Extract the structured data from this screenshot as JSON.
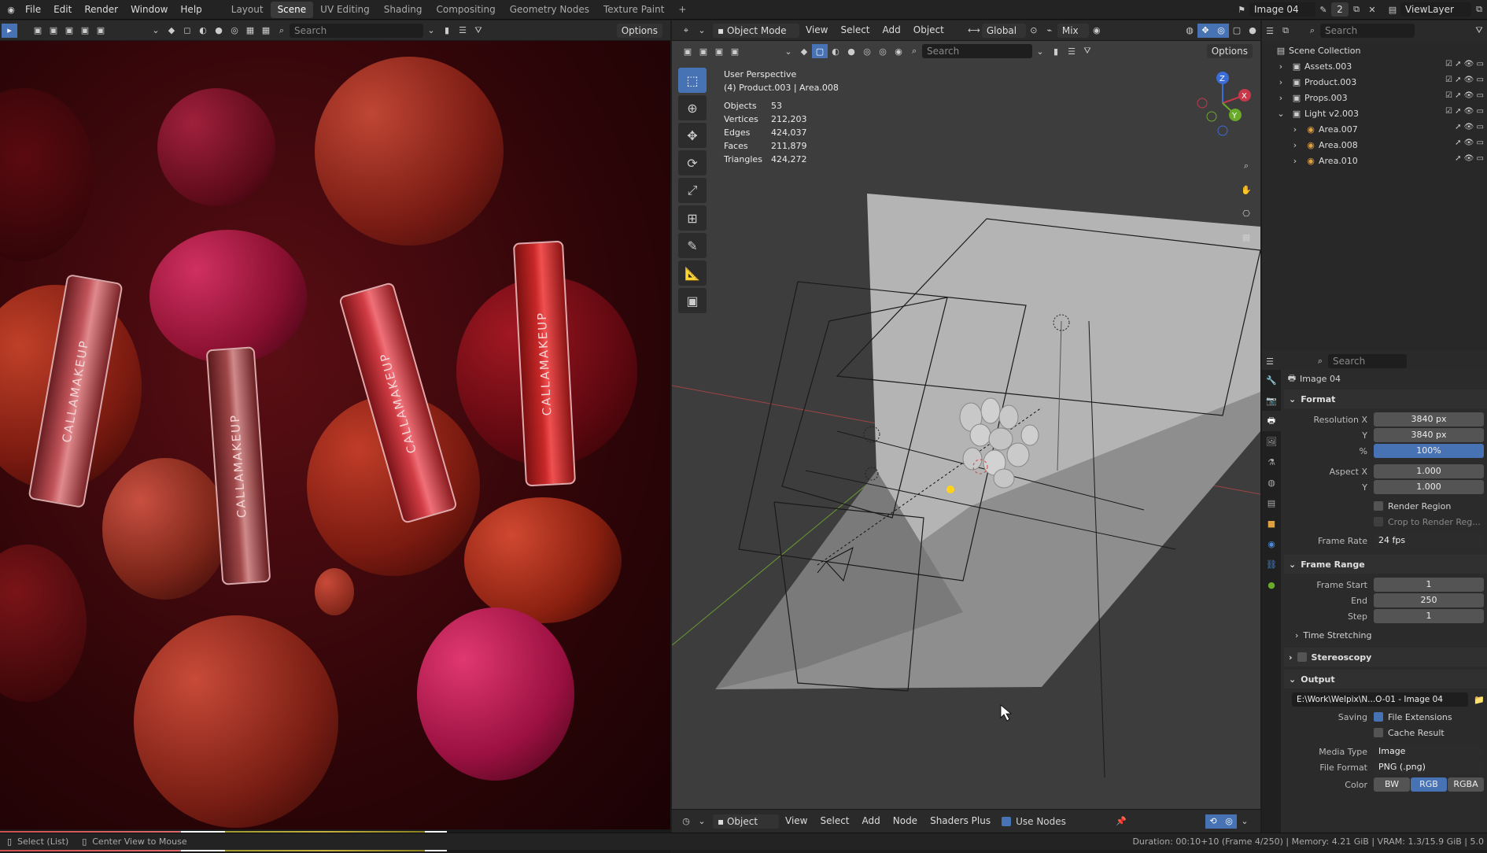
{
  "topbar": {
    "menus": [
      "File",
      "Edit",
      "Render",
      "Window",
      "Help"
    ],
    "workspaces": [
      "Layout",
      "Scene",
      "UV Editing",
      "Shading",
      "Compositing",
      "Geometry Nodes",
      "Texture Paint"
    ],
    "active_workspace": "Scene",
    "add_tab": "+",
    "scene_name": "Image 04",
    "scene_users": "2",
    "view_layer": "ViewLayer"
  },
  "image_editor": {
    "search_placeholder": "Search",
    "options_label": "Options",
    "render_label": "CALLAMAKEUP"
  },
  "viewport": {
    "mode": "Object Mode",
    "menus": [
      "View",
      "Select",
      "Add",
      "Object"
    ],
    "orientation": "Global",
    "snap_mode": "Mix",
    "search_placeholder": "Search",
    "options_label": "Options",
    "perspective": "User Perspective",
    "active_object": "(4) Product.003 | Area.008",
    "stats": [
      {
        "label": "Objects",
        "value": "53"
      },
      {
        "label": "Vertices",
        "value": "212,203"
      },
      {
        "label": "Edges",
        "value": "424,037"
      },
      {
        "label": "Faces",
        "value": "211,879"
      },
      {
        "label": "Triangles",
        "value": "424,272"
      }
    ],
    "gizmo": {
      "x": "X",
      "y": "Y",
      "z": "Z"
    }
  },
  "node_editor": {
    "type": "Object",
    "menus": [
      "View",
      "Select",
      "Add",
      "Node",
      "Shaders Plus"
    ],
    "use_nodes_label": "Use Nodes"
  },
  "outliner": {
    "search_placeholder": "Search",
    "root": "Scene Collection",
    "items": [
      {
        "name": "Assets.003",
        "indent": 1,
        "expanded": false
      },
      {
        "name": "Product.003",
        "indent": 1,
        "expanded": false
      },
      {
        "name": "Props.003",
        "indent": 1,
        "expanded": false
      },
      {
        "name": "Light v2.003",
        "indent": 1,
        "expanded": true
      },
      {
        "name": "Area.007",
        "indent": 2,
        "expanded": false
      },
      {
        "name": "Area.008",
        "indent": 2,
        "expanded": false
      },
      {
        "name": "Area.010",
        "indent": 2,
        "expanded": false
      }
    ]
  },
  "properties": {
    "search_placeholder": "Search",
    "context_name": "Image 04",
    "format": {
      "title": "Format",
      "resolution_x_label": "Resolution X",
      "resolution_x": "3840 px",
      "resolution_y_label": "Y",
      "resolution_y": "3840 px",
      "percent_label": "%",
      "percent": "100%",
      "aspect_x_label": "Aspect X",
      "aspect_x": "1.000",
      "aspect_y_label": "Y",
      "aspect_y": "1.000",
      "render_region": "Render Region",
      "crop": "Crop to Render Reg...",
      "frame_rate_label": "Frame Rate",
      "frame_rate": "24 fps"
    },
    "frame_range": {
      "title": "Frame Range",
      "start_label": "Frame Start",
      "start": "1",
      "end_label": "End",
      "end": "250",
      "step_label": "Step",
      "step": "1",
      "time_stretching": "Time Stretching"
    },
    "stereoscopy": "Stereoscopy",
    "output": {
      "title": "Output",
      "path": "E:\\Work\\Welpix\\N...O-01 - Image 04",
      "saving_label": "Saving",
      "file_extensions": "File Extensions",
      "cache_result": "Cache Result",
      "media_type_label": "Media Type",
      "media_type": "Image",
      "file_format_label": "File Format",
      "file_format": "PNG (.png)",
      "color_label": "Color",
      "color_options": [
        "BW",
        "RGB",
        "RGBA"
      ],
      "color_selected": "RGB"
    }
  },
  "statusbar": {
    "left1": "Select (List)",
    "left2": "Center View to Mouse",
    "right": "Duration: 00:10+10 (Frame 4/250) | Memory: 4.21 GiB | VRAM: 1.3/15.9 GiB | 5.0"
  },
  "colors": {
    "accent": "#4772b3",
    "header": "#2a2a2a",
    "viewport": "#3d3d3d"
  }
}
